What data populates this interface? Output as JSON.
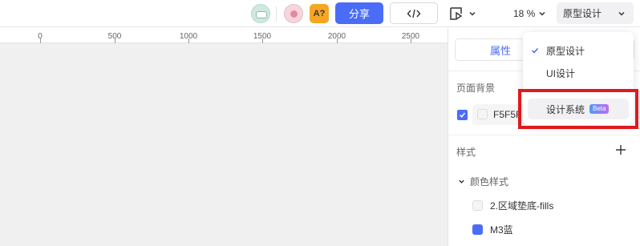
{
  "toolbar": {
    "ai_label": "A?",
    "share_label": "分享",
    "zoom_value": "18 %",
    "mode_value": "原型设计"
  },
  "ruler": {
    "ticks": [
      "0",
      "500",
      "1000",
      "1500",
      "2000",
      "2500"
    ]
  },
  "panel": {
    "tab_active": "属性",
    "page_bg_title": "页面背景",
    "page_bg_value": "F5F5F",
    "styles_title": "样式",
    "color_group": "颜色样式",
    "color_styles": [
      {
        "label": "2.区域垫底-fills",
        "color": "#f5f5f5"
      },
      {
        "label": "M3蓝",
        "color": "#4a6cf7"
      }
    ]
  },
  "dropdown": {
    "items": [
      {
        "label": "原型设计",
        "checked": true
      },
      {
        "label": "UI设计",
        "checked": false
      },
      {
        "label": "设计系统",
        "badge": "Beta",
        "hover": true
      }
    ]
  },
  "colors": {
    "accent": "#4a6cf7",
    "highlight": "#e0191e",
    "ai_button": "#f6a623"
  }
}
